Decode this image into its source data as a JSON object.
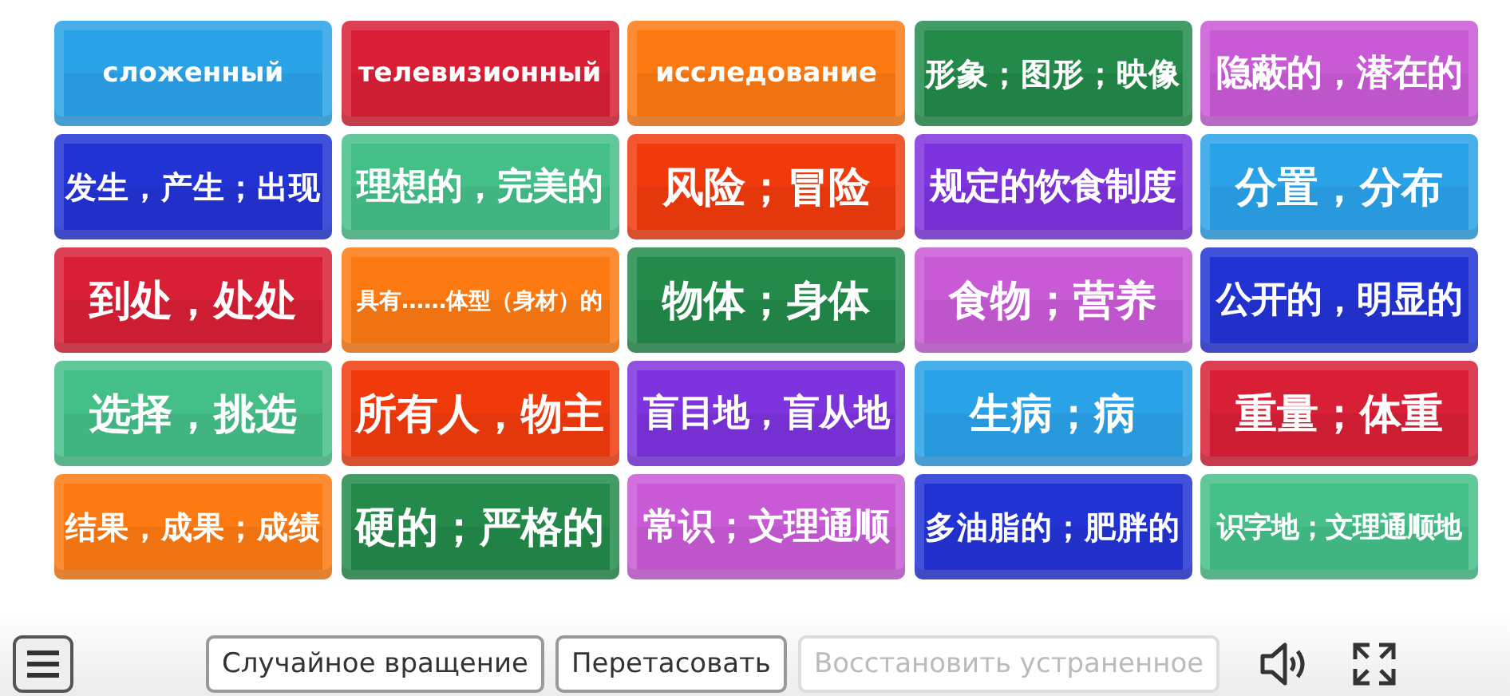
{
  "tiles": [
    {
      "text": "сложенный",
      "color": "#2aa2e8"
    },
    {
      "text": "телевизионный",
      "color": "#d91f35"
    },
    {
      "text": "исследование",
      "color": "#fd7a12"
    },
    {
      "text": "形象；图形；映像",
      "color": "#238a4a"
    },
    {
      "text": "隐蔽的，潜在的",
      "color": "#c95ad6"
    },
    {
      "text": "发生，产生；出现",
      "color": "#2233d4"
    },
    {
      "text": "理想的，完美的",
      "color": "#45bf88"
    },
    {
      "text": "风险；冒险",
      "color": "#f13a0c"
    },
    {
      "text": "规定的饮食制度",
      "color": "#7d33dd"
    },
    {
      "text": "分置，分布",
      "color": "#2aa2e8"
    },
    {
      "text": "到处，处处",
      "color": "#d91f35"
    },
    {
      "text": "具有……体型（身材）的",
      "color": "#fd7a12"
    },
    {
      "text": "物体；身体",
      "color": "#238a4a"
    },
    {
      "text": "食物；营养",
      "color": "#c95ad6"
    },
    {
      "text": "公开的，明显的",
      "color": "#2233d4"
    },
    {
      "text": "选择，挑选",
      "color": "#45bf88"
    },
    {
      "text": "所有人，物主",
      "color": "#f13a0c"
    },
    {
      "text": "盲目地，盲从地",
      "color": "#7d33dd"
    },
    {
      "text": "生病；病",
      "color": "#2aa2e8"
    },
    {
      "text": "重量；体重",
      "color": "#d91f35"
    },
    {
      "text": "结果，成果；成绩",
      "color": "#fd7a12"
    },
    {
      "text": "硬的；严格的",
      "color": "#238a4a"
    },
    {
      "text": "常识；文理通顺",
      "color": "#c95ad6"
    },
    {
      "text": "多油脂的；肥胖的",
      "color": "#2233d4"
    },
    {
      "text": "识字地；文理通顺地",
      "color": "#45bf88"
    }
  ],
  "toolbar": {
    "buttons": [
      {
        "label": "Случайное вращение",
        "disabled": false
      },
      {
        "label": "Перетасовать",
        "disabled": false
      },
      {
        "label": "Восстановить устраненное",
        "disabled": true
      }
    ]
  }
}
